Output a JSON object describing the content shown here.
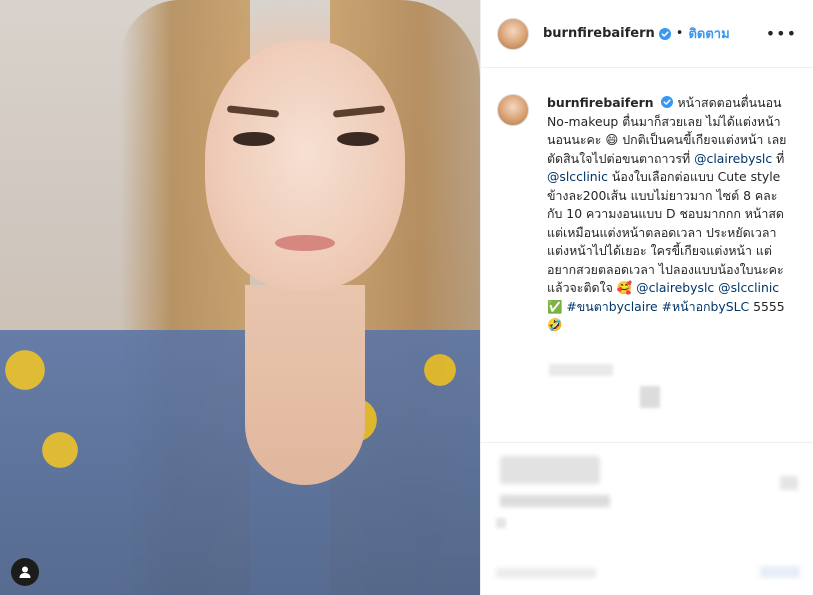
{
  "header": {
    "username": "burnfirebaifern",
    "separator": "•",
    "follow_label": "ติดตาม",
    "more_label": "•••"
  },
  "caption": {
    "username": "burnfirebaifern",
    "text_1": "หน้าสดตอนตื่นนอน No-makeup ตื่นมาก็สวยเลย ไม่ได้แต่งหน้านอนนะคะ 😄 ปกติเป็นคนขี้เกียจแต่งหน้า เลยตัดสินใจไปต่อขนตาถาวรที่ ",
    "mention_1": "@clairebyslc",
    "text_2": " ที่ ",
    "mention_2": "@slcclinic",
    "text_3": " น้องใบเลือกต่อแบบ Cute style ข้างละ200เส้น แบบไม่ยาวมาก ไซต์ 8 คละกับ 10 ความงอนแบบ D ชอบมากกก หน้าสดแต่เหมือนแต่งหน้าตลอดเวลา ประหยัดเวลาแต่งหน้าไปได้เยอะ ใครขี้เกียจแต่งหน้า แต่อยากสวยตลอดเวลา ไปลองแบบน้องใบนะคะ แล้วจะติดใจ 🥰 ",
    "mention_3": "@clairebyslc",
    "text_4": " ",
    "mention_4": "@slcclinic",
    "text_5": " ✅ ",
    "hashtag_1": "#ขนตาbyclaire",
    "text_6": " ",
    "hashtag_2": "#หน้าอกbySLC",
    "text_7": " 5555 🤣"
  },
  "colors": {
    "link": "#003569",
    "follow": "#3897f0",
    "verified": "#3897f0"
  },
  "icons": {
    "verified": "verified-badge-icon",
    "user_tag": "person-icon"
  }
}
